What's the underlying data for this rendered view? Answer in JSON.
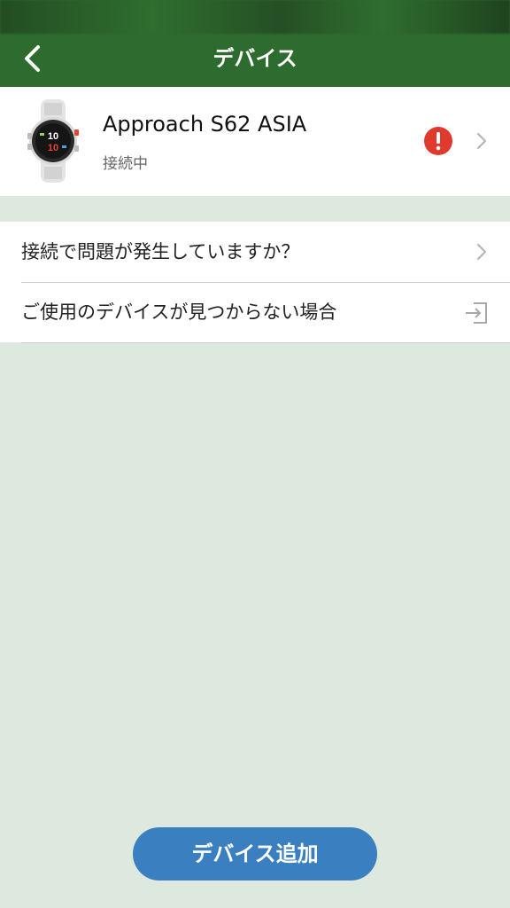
{
  "header": {
    "title": "デバイス",
    "back_icon": "chevron-left-icon",
    "background_color": "#2e6b2e"
  },
  "device": {
    "name": "Approach S62 ASIA",
    "status": "接続中",
    "watch_time_hours": "10",
    "watch_time_minutes": "10",
    "alert_icon": "exclamation-alert-icon",
    "alert_color": "#e03a2e"
  },
  "list": {
    "items": [
      {
        "label": "接続で問題が発生していますか？",
        "icon": "chevron-right-icon"
      },
      {
        "label": "ご使用のデバイスが見つからない場合",
        "icon": "exit-arrow-icon"
      }
    ]
  },
  "actions": {
    "add_device_label": "デバイス追加",
    "button_color": "#3a7fbf"
  }
}
